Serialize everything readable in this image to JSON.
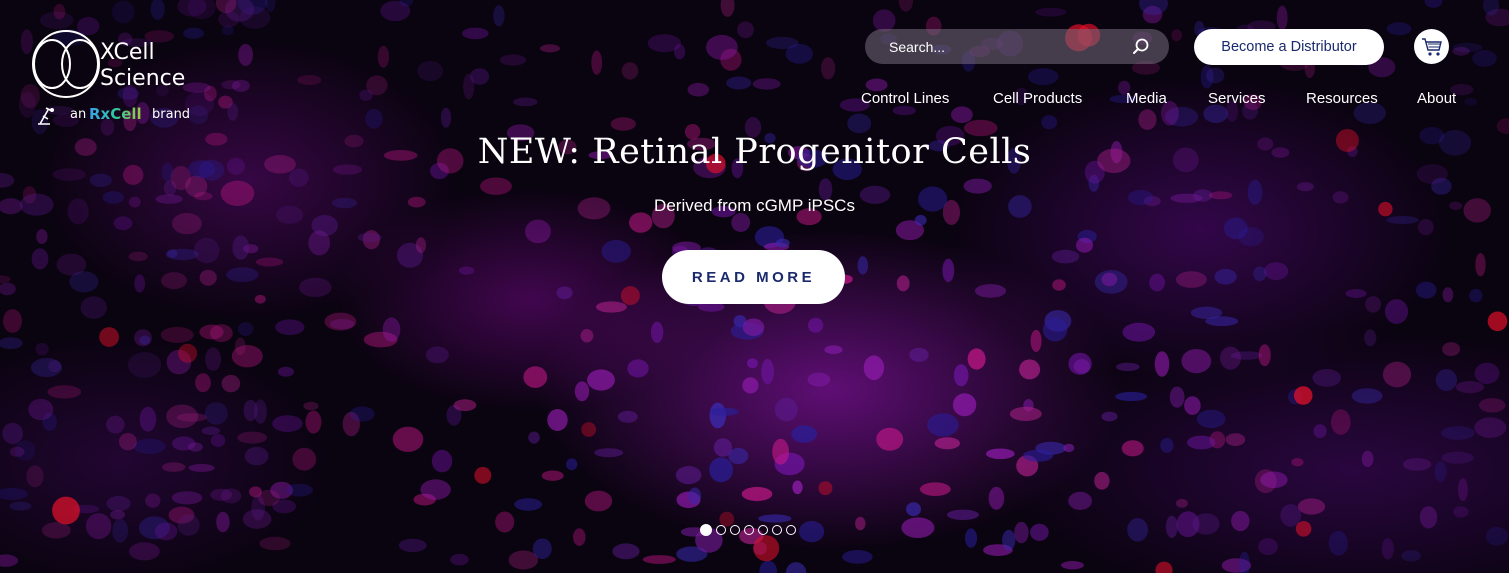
{
  "logo": {
    "line1": "XCell",
    "line2": "Science",
    "brand_prefix": "an",
    "brand_name": "RxCell",
    "brand_suffix": "brand"
  },
  "search": {
    "placeholder": "Search..."
  },
  "header": {
    "distributor_label": "Become a Distributor",
    "cart_icon": "cart-icon"
  },
  "nav": {
    "items": [
      {
        "label": "Control Lines"
      },
      {
        "label": "Cell Products"
      },
      {
        "label": "Media"
      },
      {
        "label": "Services"
      },
      {
        "label": "Resources"
      },
      {
        "label": "About"
      }
    ]
  },
  "hero": {
    "title": "NEW: Retinal Progenitor Cells",
    "subtitle": "Derived from cGMP iPSCs",
    "cta_label": "READ MORE"
  },
  "slider": {
    "count": 7,
    "active_index": 0
  },
  "colors": {
    "accent": "#1a2a6c",
    "overlay_purple": "#8c14aa"
  }
}
